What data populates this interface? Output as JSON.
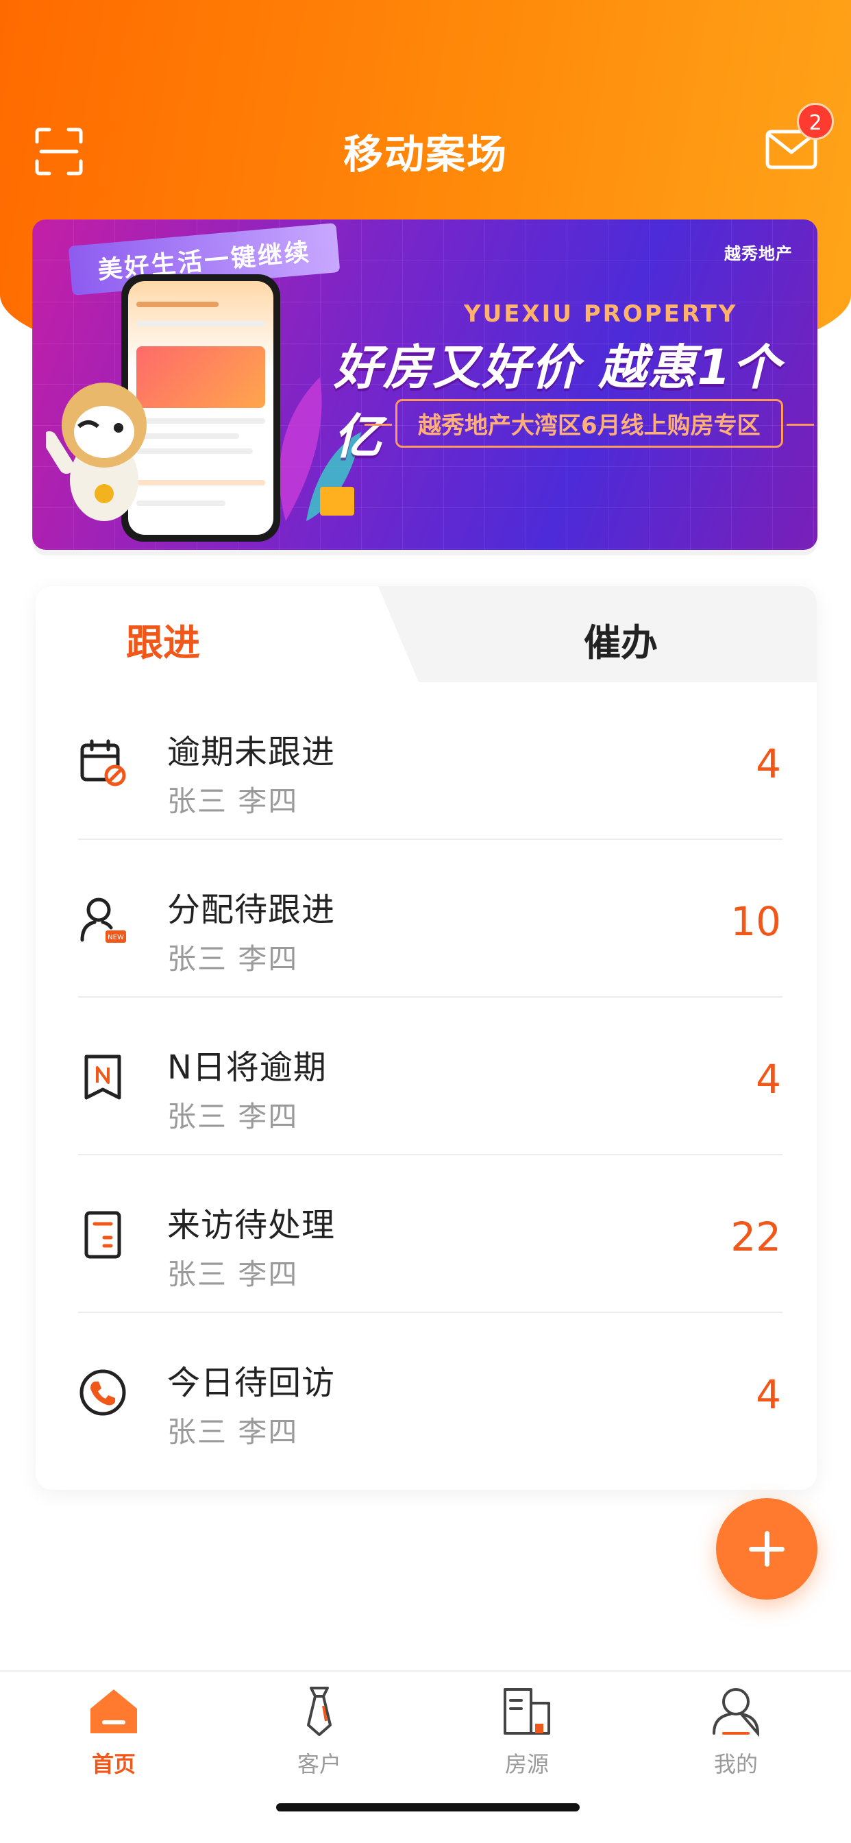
{
  "header": {
    "title": "移动案场",
    "mail_badge": "2"
  },
  "banner": {
    "ribbon": "美好生活一键继续",
    "brand": "越秀地产",
    "en_title": "YUEXIU PROPERTY",
    "slogan": "好房又好价 越惠1个亿",
    "sub_slogan": "越秀地产大湾区6月线上购房专区"
  },
  "tabs": [
    {
      "label": "跟进",
      "active": true
    },
    {
      "label": "催办",
      "active": false
    }
  ],
  "followups": [
    {
      "title": "逾期未跟进",
      "names": "张三 李四",
      "count": "4",
      "icon": "calendar-overdue-icon"
    },
    {
      "title": "分配待跟进",
      "names": "张三 李四",
      "count": "10",
      "icon": "user-new-icon"
    },
    {
      "title": "N日将逾期",
      "names": "张三 李四",
      "count": "4",
      "icon": "bookmark-n-icon"
    },
    {
      "title": "来访待处理",
      "names": "张三 李四",
      "count": "22",
      "icon": "document-icon"
    },
    {
      "title": "今日待回访",
      "names": "张三 李四",
      "count": "4",
      "icon": "phone-icon"
    }
  ],
  "bottom_nav": [
    {
      "label": "首页",
      "icon": "home-icon",
      "active": true
    },
    {
      "label": "客户",
      "icon": "tie-icon",
      "active": false
    },
    {
      "label": "房源",
      "icon": "building-icon",
      "active": false
    },
    {
      "label": "我的",
      "icon": "person-icon",
      "active": false
    }
  ],
  "colors": {
    "accent": "#f2571a",
    "header_gradient_start": "#ff6a00",
    "header_gradient_end": "#ffa51a",
    "muted_text": "#9a9a9a",
    "badge": "#ff3b30"
  }
}
